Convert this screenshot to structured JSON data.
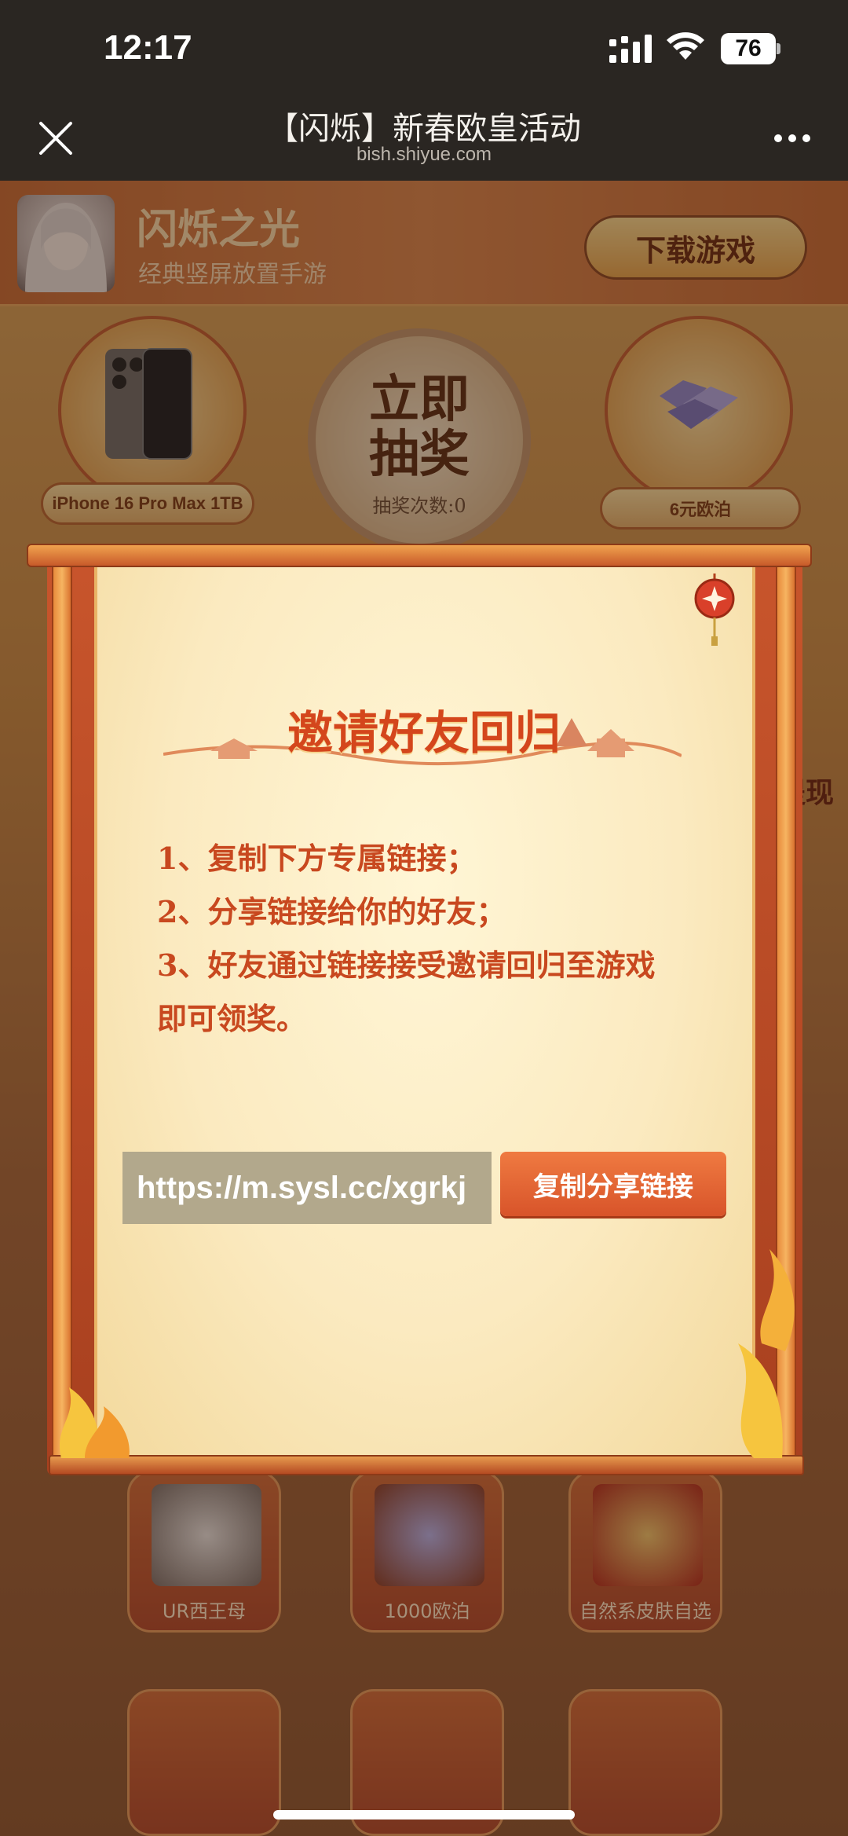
{
  "status_bar": {
    "time": "12:17",
    "battery": "76"
  },
  "nav": {
    "title": "【闪烁】新春欧皇活动",
    "url": "bish.shiyue.com"
  },
  "app_banner": {
    "name": "闪烁之光",
    "subtitle": "经典竖屏放置手游",
    "download_label": "下载游戏"
  },
  "lottery": {
    "draw_label": "立即抽奖",
    "draw_line1": "立即",
    "draw_line2": "抽奖",
    "draw_count": "抽奖次数:0",
    "prizes": [
      {
        "label": "iPhone 16 Pro Max 1TB"
      },
      {
        "label": "6元欧泊"
      }
    ],
    "side_text": "提现"
  },
  "rewards": [
    {
      "label": "UR西王母"
    },
    {
      "label": "1000欧泊"
    },
    {
      "label": "自然系皮肤自选"
    }
  ],
  "modal": {
    "title": "邀请好友回归",
    "steps": [
      "1、复制下方专属链接；",
      "2、分享链接给你的好友；",
      "3、好友通过链接接受邀请回归至游戏",
      "即可领奖。"
    ],
    "link": "https://m.sysl.cc/xgrkj",
    "copy_button": "复制分享链接"
  },
  "colors": {
    "accent": "#d8542a",
    "title": "#d4461c",
    "paper": "#fbeac0"
  }
}
